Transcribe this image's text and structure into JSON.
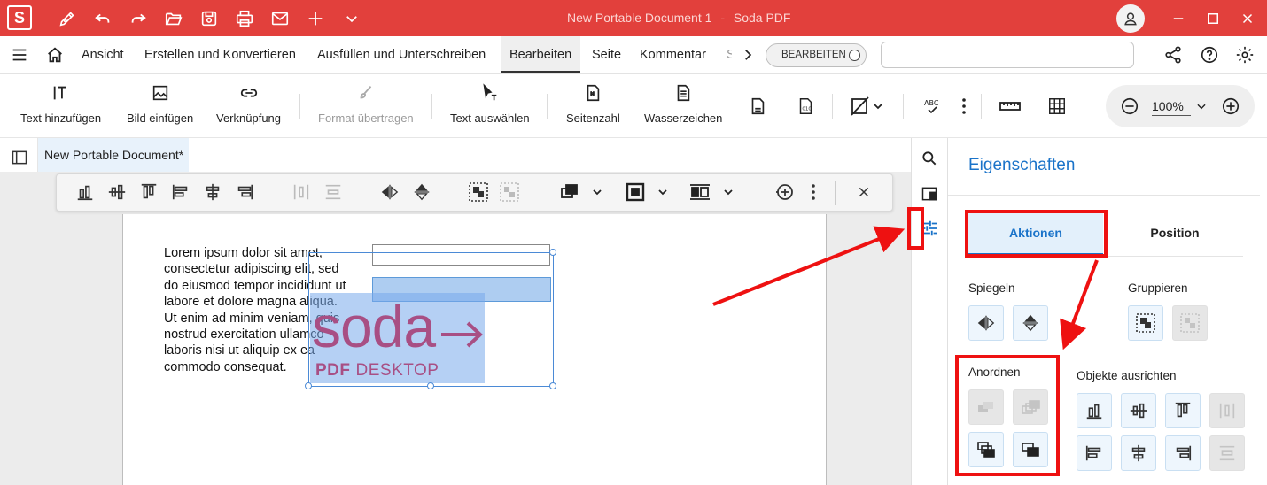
{
  "app": {
    "logo_letter": "S",
    "doc_name": "New Portable Document 1",
    "separator": "-",
    "app_name": "Soda PDF"
  },
  "menu": {
    "items": [
      "Ansicht",
      "Erstellen und Konvertieren",
      "Ausfüllen und Unterschreiben",
      "Bearbeiten",
      "Seite",
      "Kommentar",
      "S"
    ],
    "active": "Bearbeiten",
    "mode_toggle": "BEARBEITEN"
  },
  "toolbar": {
    "tools": [
      "Text hinzufügen",
      "Bild einfügen",
      "Verknüpfung",
      "Format übertragen",
      "Text auswählen",
      "Seitenzahl",
      "Wasserzeichen"
    ],
    "zoom": "100%"
  },
  "document": {
    "tab_title": "New Portable Document*",
    "lorem_lines": [
      "Lorem ipsum dolor sit amet,",
      "consectetur adipiscing elit, sed",
      "do eiusmod tempor incididunt ut",
      "labore et dolore magna aliqua.",
      "Ut enim ad minim veniam, quis",
      "nostrud exercitation ullamco",
      "laboris nisi ut aliquip ex ea",
      "commodo consequat."
    ],
    "image_word": "soda",
    "image_sub_bold": "PDF",
    "image_sub": "DESKTOP"
  },
  "panel": {
    "title": "Eigenschaften",
    "tab_actions": "Aktionen",
    "tab_position": "Position",
    "mirror": "Spiegeln",
    "group": "Gruppieren",
    "arrange": "Anordnen",
    "align": "Objekte ausrichten"
  },
  "colors": {
    "brand_red": "#e2403c",
    "accent_blue": "#1a73c9",
    "annotation_red": "#ee1111",
    "logo_purple": "#a84f84"
  }
}
